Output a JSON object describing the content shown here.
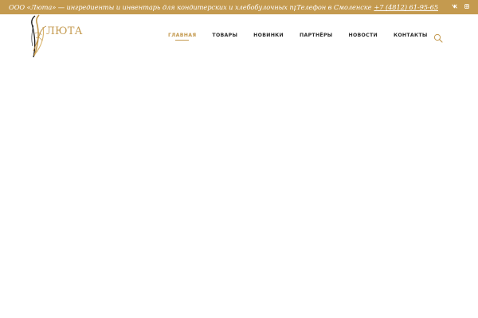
{
  "topbar": {
    "tagline": "ООО «Люта» — ингредиенты и инвентарь для кондитерских и хлебобулочных производств",
    "phone_label": "Телефон в Смоленске",
    "phone_number": "+7 (4812) 61-95-65",
    "social": [
      "vk-icon",
      "instagram-icon"
    ],
    "background_color": "#c49a4f"
  },
  "logo": {
    "text": "ЛЮТА",
    "color": "#c49a4f"
  },
  "nav": {
    "items": [
      "Главная",
      "Товары",
      "Новинки",
      "Партнёры",
      "Новости",
      "Контакты"
    ],
    "active_index": 0,
    "active_color": "#c49a4f",
    "search_icon": "search-icon"
  }
}
